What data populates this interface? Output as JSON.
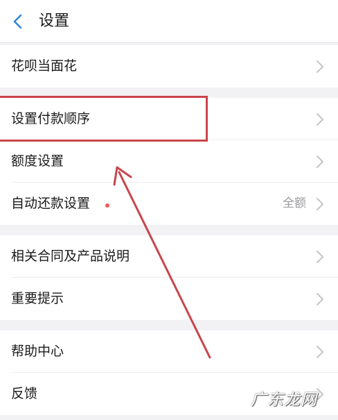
{
  "header": {
    "title": "设置"
  },
  "sections": [
    {
      "items": [
        {
          "label": "花呗当面花",
          "value": ""
        }
      ]
    },
    {
      "items": [
        {
          "label": "设置付款顺序",
          "value": ""
        },
        {
          "label": "额度设置",
          "value": ""
        },
        {
          "label": "自动还款设置",
          "value": "全额"
        }
      ]
    },
    {
      "items": [
        {
          "label": "相关合同及产品说明",
          "value": ""
        },
        {
          "label": "重要提示",
          "value": ""
        }
      ]
    },
    {
      "items": [
        {
          "label": "帮助中心",
          "value": ""
        },
        {
          "label": "反馈",
          "value": ""
        }
      ]
    }
  ],
  "watermark": {
    "text": "广东龙网"
  },
  "colors": {
    "accent": "#2f86d6",
    "annotation": "#c8454a",
    "chevron": "#c4c4c9",
    "badge": "#f05a5a"
  }
}
